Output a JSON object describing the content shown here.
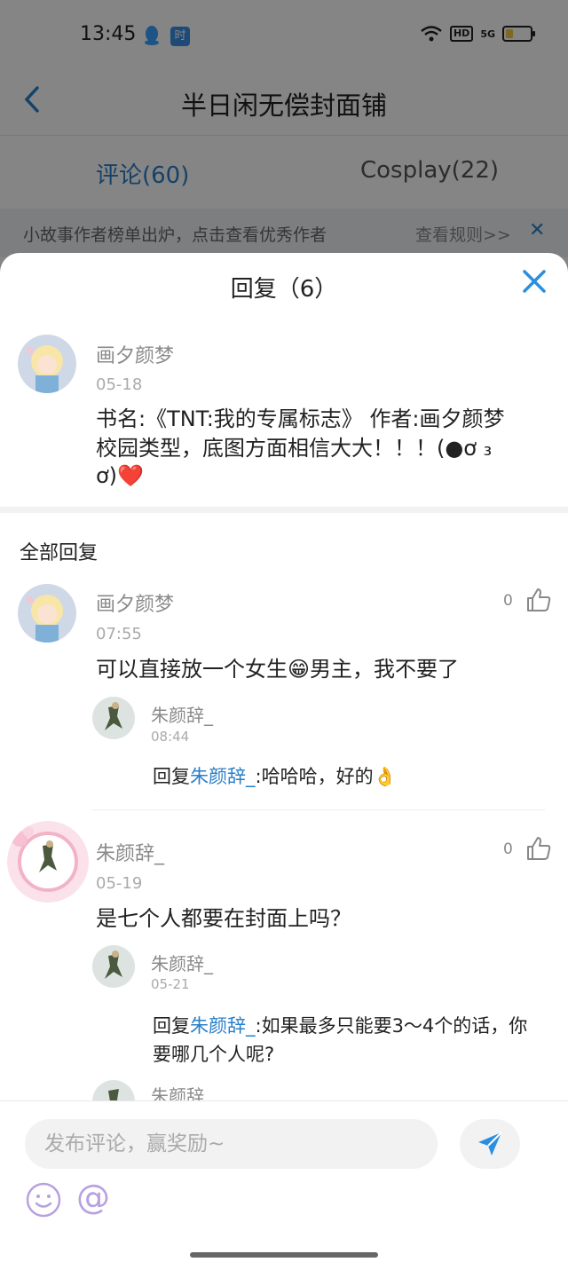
{
  "status_bar": {
    "time": "13:45",
    "app_icon_label": "时",
    "hd": "HD",
    "network": "5G"
  },
  "nav": {
    "title": "半日闲无偿封面铺"
  },
  "tabs": [
    {
      "label": "评论(60)",
      "active": true
    },
    {
      "label": "Cosplay(22)",
      "active": false
    }
  ],
  "notice": {
    "text": "小故事作者榜单出炉，点击查看优秀作者",
    "rules": "查看规则>>"
  },
  "sheet": {
    "title": "回复（6）",
    "post": {
      "username": "画夕颜梦",
      "date": "05-18",
      "line1": "书名:《TNT:我的专属标志》 作者:画夕颜梦",
      "line2": "校园类型，底图方面相信大大！！！(●ơ ₃",
      "line3": "ơ)❤️"
    },
    "all_replies_label": "全部回复",
    "replies": [
      {
        "username": "画夕颜梦",
        "date": "07:55",
        "text": "可以直接放一个女生😁男主，我不要了",
        "likes": "0",
        "sub": {
          "username": "朱颜辞_",
          "date": "08:44",
          "prefix": "回复",
          "mention": "朱颜辞_",
          "text": ":哈哈哈，好的👌"
        }
      },
      {
        "username": "朱颜辞_",
        "date": "05-19",
        "text": "是七个人都要在封面上吗？",
        "likes": "0",
        "sub": {
          "username": "朱颜辞_",
          "date": "05-21",
          "prefix": "回复",
          "mention": "朱颜辞_",
          "text_line1": ":如果最多只能要3～4个的话，你",
          "text_line2": "要哪几个人呢?"
        },
        "sub2_username": "朱颜辞"
      }
    ]
  },
  "input": {
    "placeholder": "发布评论，赢奖励~",
    "at_symbol": "@"
  },
  "colors": {
    "accent": "#2a7fc9",
    "overlay": "rgba(0,0,0,0.48)"
  }
}
